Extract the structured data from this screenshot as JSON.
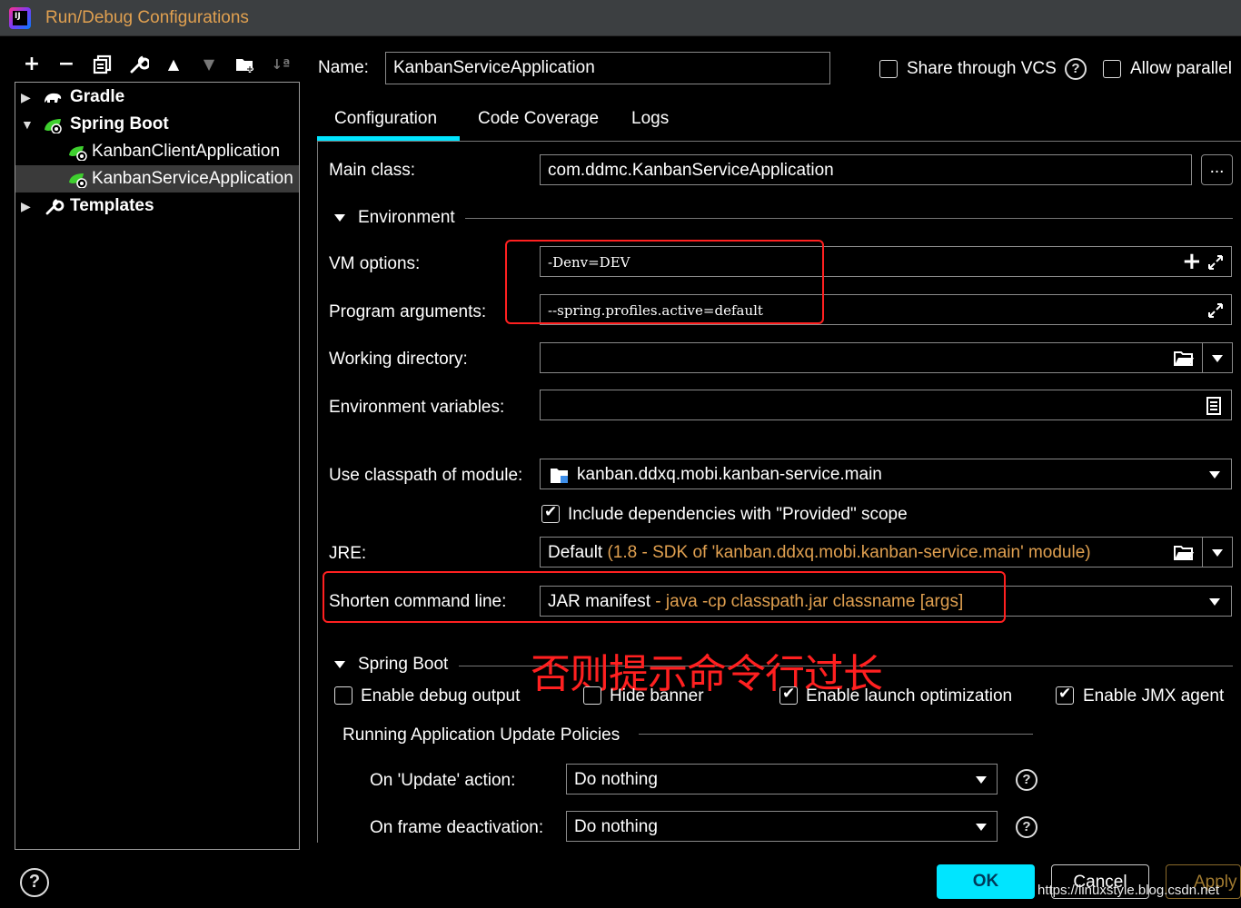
{
  "window": {
    "title": "Run/Debug Configurations",
    "app_icon_text": "IJ"
  },
  "toolbar": {
    "add": "+",
    "remove": "−",
    "copy": "⧉",
    "edit": "🔧",
    "up": "▲",
    "down": "▼",
    "folder": "📁",
    "sort": "↓ª"
  },
  "tree": {
    "items": [
      {
        "label": "Gradle",
        "icon": "gradle-elephant-icon"
      },
      {
        "label": "Spring Boot",
        "icon": "spring-boot-icon"
      },
      {
        "label": "KanbanClientApplication",
        "icon": "spring-boot-run-icon"
      },
      {
        "label": "KanbanServiceApplication",
        "icon": "spring-boot-run-icon"
      },
      {
        "label": "Templates",
        "icon": "wrench-icon"
      }
    ]
  },
  "header": {
    "name_label": "Name:",
    "name_value": "KanbanServiceApplication",
    "share_vcs": "Share through VCS",
    "allow_parallel": "Allow parallel"
  },
  "tabs": [
    "Configuration",
    "Code Coverage",
    "Logs"
  ],
  "config": {
    "main_class_label": "Main class:",
    "main_class_value": "com.ddmc.KanbanServiceApplication",
    "browse": "...",
    "environment_section": "Environment",
    "vm_options_label": "VM options:",
    "vm_options_value": "-Denv=DEV",
    "program_args_label": "Program arguments:",
    "program_args_value": "--spring.profiles.active=default",
    "working_dir_label": "Working directory:",
    "working_dir_value": "",
    "env_vars_label": "Environment variables:",
    "env_vars_value": "",
    "classpath_label": "Use classpath of module:",
    "classpath_value": "kanban.ddxq.mobi.kanban-service.main",
    "include_deps": "Include dependencies with \"Provided\" scope",
    "jre_label": "JRE:",
    "jre_value": "Default",
    "jre_detail": " (1.8 - SDK of 'kanban.ddxq.mobi.kanban-service.main' module)",
    "shorten_label": "Shorten command line:",
    "shorten_value": "JAR manifest",
    "shorten_detail": " - java -cp classpath.jar classname [args]"
  },
  "spring_boot": {
    "section": "Spring Boot",
    "debug_output": "Enable debug output",
    "hide_banner": "Hide banner",
    "launch_opt": "Enable launch optimization",
    "jmx_agent": "Enable JMX agent",
    "policies_title": "Running Application Update Policies",
    "update_label": "On 'Update' action:",
    "update_value": "Do nothing",
    "frame_label": "On frame deactivation:",
    "frame_value": "Do nothing"
  },
  "checkbox_state": {
    "share_vcs": false,
    "allow_parallel": false,
    "include_deps": true,
    "debug_output": false,
    "hide_banner": false,
    "launch_opt": true,
    "jmx_agent": true
  },
  "annotation": "否则提示命令行过长",
  "footer": {
    "ok": "OK",
    "cancel": "Cancel",
    "apply": "Apply",
    "watermark": "https://linuxstyle.blog.csdn.net"
  },
  "colors": {
    "accent": "#00e5ff",
    "detail": "#e0a050",
    "annotation": "#ff2020",
    "spring": "#3ecf2e"
  }
}
